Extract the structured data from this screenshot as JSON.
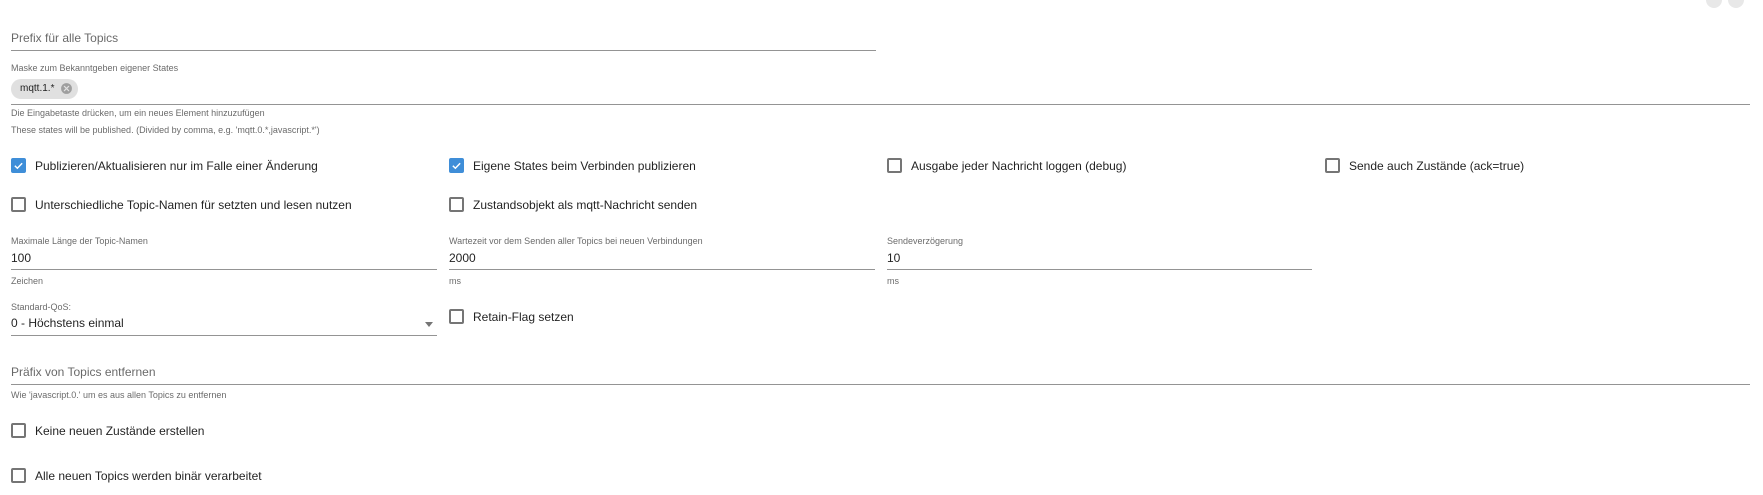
{
  "prefix_all_topics": {
    "placeholder": "Prefix für alle Topics",
    "value": ""
  },
  "publish_mask": {
    "label": "Maske zum Bekanntgeben eigener States",
    "chips": [
      "mqtt.1.*"
    ],
    "helper_line1": "Die Eingabetaste drücken, um ein neues Element hinzuzufügen",
    "helper_line2": "These states will be published. (Divided by comma, e.g. 'mqtt.0.*,javascript.*')"
  },
  "checkboxes_row1": [
    {
      "label": "Publizieren/Aktualisieren nur im Falle einer Änderung",
      "checked": true
    },
    {
      "label": "Eigene States beim Verbinden publizieren",
      "checked": true
    },
    {
      "label": "Ausgabe jeder Nachricht loggen (debug)",
      "checked": false
    },
    {
      "label": "Sende auch Zustände (ack=true)",
      "checked": false
    }
  ],
  "checkboxes_row2": [
    {
      "label": "Unterschiedliche Topic-Namen für setzten und lesen nutzen",
      "checked": false
    },
    {
      "label": "Zustandsobjekt als mqtt-Nachricht senden",
      "checked": false
    }
  ],
  "max_topic_length": {
    "label": "Maximale Länge der Topic-Namen",
    "value": "100",
    "unit": "Zeichen"
  },
  "wait_time": {
    "label": "Wartezeit vor dem Senden aller Topics bei neuen Verbindungen",
    "value": "2000",
    "unit": "ms"
  },
  "send_delay": {
    "label": "Sendeverzögerung",
    "value": "10",
    "unit": "ms"
  },
  "default_qos": {
    "label": "Standard-QoS:",
    "value": "0 - Höchstens einmal"
  },
  "retain_flag": {
    "label": "Retain-Flag setzen",
    "checked": false
  },
  "remove_prefix": {
    "placeholder": "Präfix von Topics entfernen",
    "helper": "Wie 'javascript.0.' um es aus allen Topics zu entfernen"
  },
  "no_new_states": {
    "label": "Keine neuen Zustände erstellen",
    "checked": false
  },
  "binary_topics": {
    "label": "Alle neuen Topics werden binär verarbeitet",
    "checked": false
  },
  "colors": {
    "accent": "#3f8ed8",
    "chip_bg": "#e0e0e0"
  }
}
